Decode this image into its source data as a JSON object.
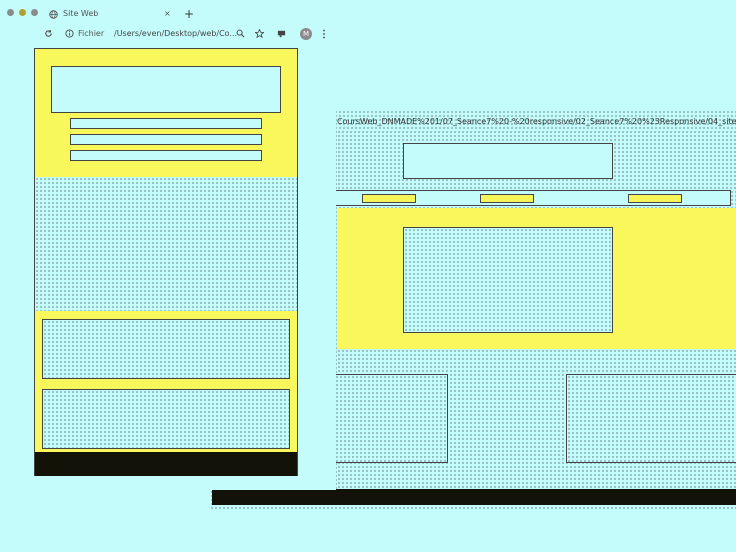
{
  "browser": {
    "tab_title": "Site Web",
    "tab_close": "×",
    "new_tab": "+",
    "reload_icon": "reload-icon",
    "info_icon": "info-icon",
    "scheme_label": "Fichier",
    "url": "/Users/even/Desktop/web/Co...",
    "avatar_letter": "M"
  },
  "background_window": {
    "url_fragment": "CoursWeb_DNMADE%201/07_Seance7%20-%20responsive/02_Seance7%20%23Responsive/04_site%20responsive/si"
  },
  "colors": {
    "background": "#c4fcfc",
    "accent_yellow": "#f8f85c",
    "footer": "#121208"
  }
}
